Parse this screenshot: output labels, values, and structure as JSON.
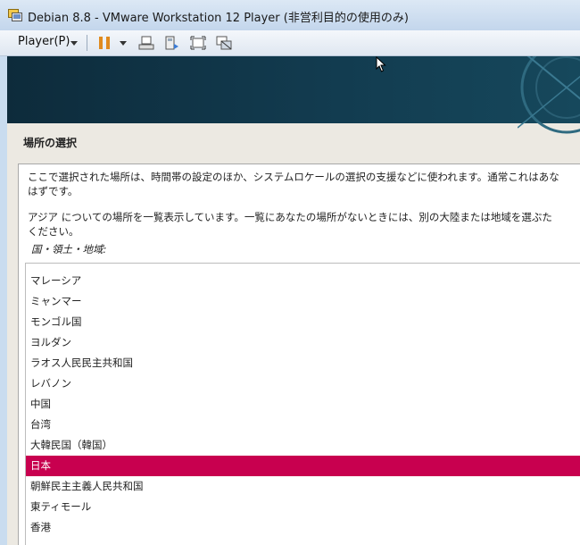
{
  "window": {
    "title": "Debian 8.8 - VMware Workstation 12 Player (非営利目的の使用のみ)"
  },
  "toolbar": {
    "player_menu": "Player(P)",
    "icons": [
      "pause-icon",
      "send-ctrl-alt-del-icon",
      "removable-devices-icon",
      "fullscreen-icon",
      "unity-icon"
    ]
  },
  "installer": {
    "section_title": "場所の選択",
    "description_1": "ここで選択された場所は、時間帯の設定のほか、システムロケールの選択の支援などに使われます。通常これはあな\nはずです。",
    "description_2": "アジア についての場所を一覧表示しています。一覧にあなたの場所がないときには、別の大陸または地域を選ぶた\nください。",
    "field_label": "国・領土・地域:",
    "countries": [
      {
        "name": "マレーシア"
      },
      {
        "name": "ミャンマー"
      },
      {
        "name": "モンゴル国"
      },
      {
        "name": "ヨルダン"
      },
      {
        "name": "ラオス人民民主共和国"
      },
      {
        "name": "レバノン"
      },
      {
        "name": "中国"
      },
      {
        "name": "台湾"
      },
      {
        "name": "大韓民国（韓国）"
      },
      {
        "name": "日本",
        "selected": true
      },
      {
        "name": "朝鮮民主主義人民共和国"
      },
      {
        "name": "東ティモール"
      },
      {
        "name": "香港"
      }
    ]
  },
  "colors": {
    "selection": "#c8004f",
    "banner": "#0d2b3b"
  }
}
